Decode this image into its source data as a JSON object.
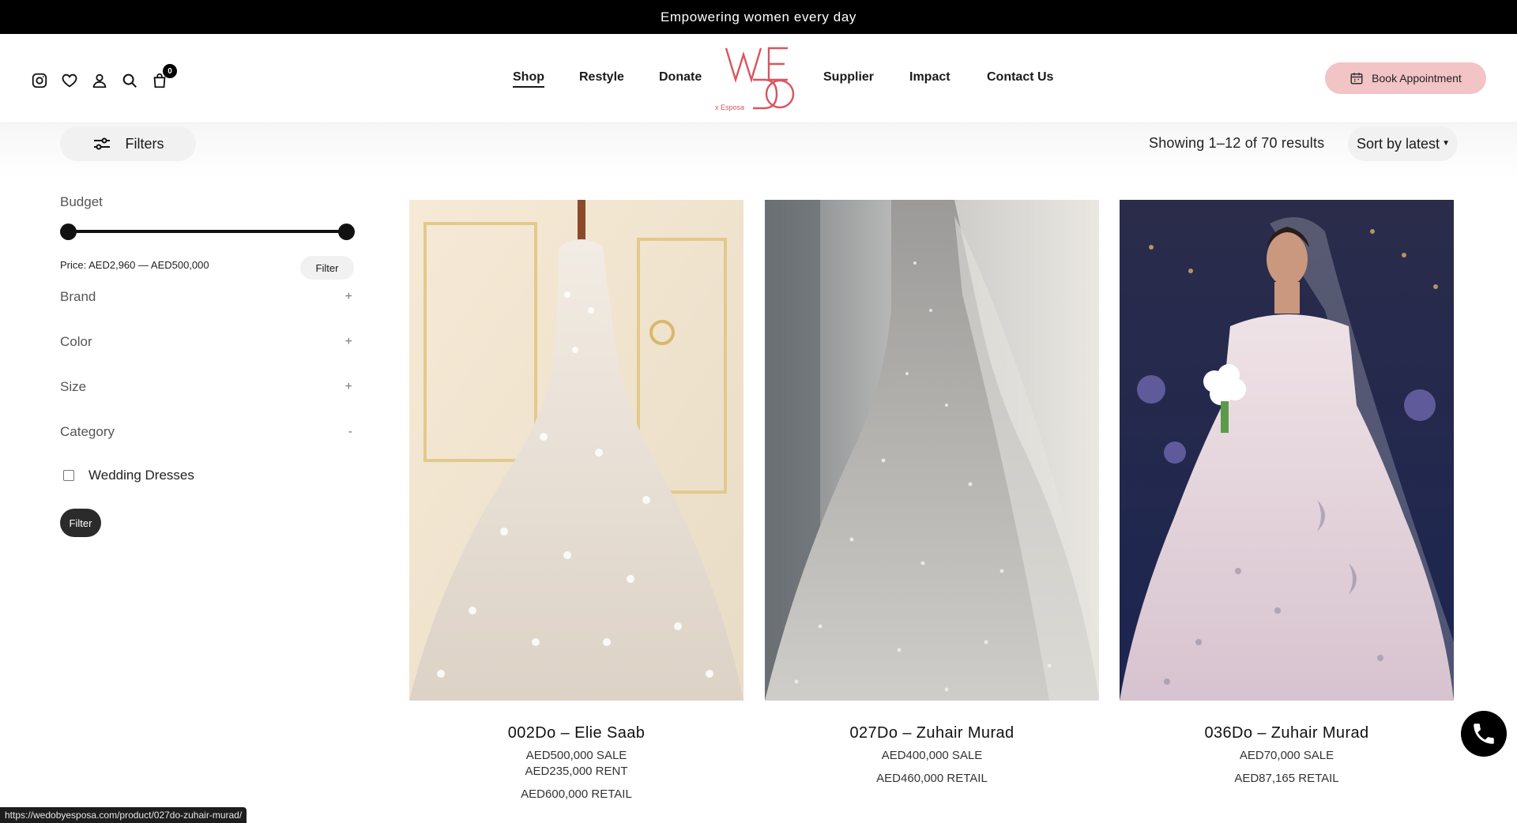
{
  "announcement": "Empowering women every day",
  "header": {
    "cart_count": "0",
    "logo_text": "WE DO",
    "logo_sub": "x Esposa",
    "nav": [
      "Shop",
      "Restyle",
      "Donate",
      "Supplier",
      "Impact",
      "Contact Us"
    ],
    "book_label": "Book Appointment",
    "icons": [
      "instagram-icon",
      "heart-icon",
      "user-icon",
      "search-icon",
      "bag-icon"
    ]
  },
  "toolbar": {
    "filters_label": "Filters",
    "results_text": "Showing 1–12 of 70 results",
    "sort_label": "Sort by latest"
  },
  "sidebar": {
    "budget_label": "Budget",
    "price_text": "Price: AED2,960 — AED500,000",
    "price_filter_label": "Filter",
    "slider_min_fraction": 0,
    "slider_max_fraction": 1,
    "facets": [
      {
        "label": "Brand",
        "sign": "+"
      },
      {
        "label": "Color",
        "sign": "+"
      },
      {
        "label": "Size",
        "sign": "+"
      },
      {
        "label": "Category",
        "sign": "-"
      }
    ],
    "category_option": "Wedding Dresses",
    "filter_label": "Filter"
  },
  "products": [
    {
      "name": "002Do – Elie Saab",
      "prices": [
        "AED500,000 SALE",
        "AED235,000 RENT",
        "AED600,000 RETAIL"
      ]
    },
    {
      "name": "027Do – Zuhair Murad",
      "prices": [
        "AED400,000 SALE",
        "AED460,000 RETAIL"
      ]
    },
    {
      "name": "036Do – Zuhair Murad",
      "prices": [
        "AED70,000 SALE",
        "AED87,165 RETAIL"
      ]
    }
  ],
  "status_url": "https://wedobyesposa.com/product/027do-zuhair-murad/",
  "colors": {
    "accent_pink": "#f2c4c5",
    "logo_red": "#d9555e",
    "dark": "#111111"
  }
}
